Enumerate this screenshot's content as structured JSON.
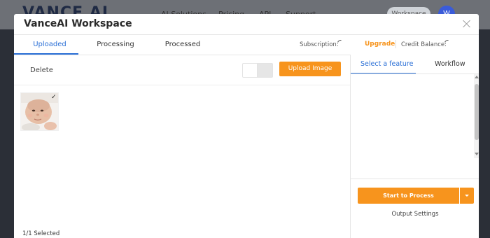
{
  "background_site": {
    "logo": "VANCE AI",
    "nav": [
      "AI Solutions",
      "Pricing",
      "API",
      "Support"
    ],
    "login_label": "Workspace",
    "avatar_initials": "W"
  },
  "modal": {
    "title": "VanceAI Workspace",
    "tabs": [
      {
        "label": "Uploaded",
        "active": true
      },
      {
        "label": "Processing",
        "active": false
      },
      {
        "label": "Processed",
        "active": false
      }
    ],
    "subscription_label": "Subscription:",
    "upgrade_label": "Upgrade",
    "credit_label": "Credit Balance:",
    "toolbar": {
      "delete_label": "Delete",
      "upload_label": "Upload Image"
    },
    "images": [
      {
        "name": "baby-photo",
        "selected": true,
        "check_glyph": "✓"
      }
    ],
    "selection_status": "1/1  Selected",
    "right_panel": {
      "tabs": [
        {
          "label": "Select a feature",
          "active": true
        },
        {
          "label": "Workflow",
          "active": false
        }
      ],
      "start_label": "Start to Process",
      "output_settings_label": "Output Settings"
    }
  },
  "colors": {
    "accent_blue": "#2a6fd6",
    "accent_orange": "#f7941d"
  }
}
